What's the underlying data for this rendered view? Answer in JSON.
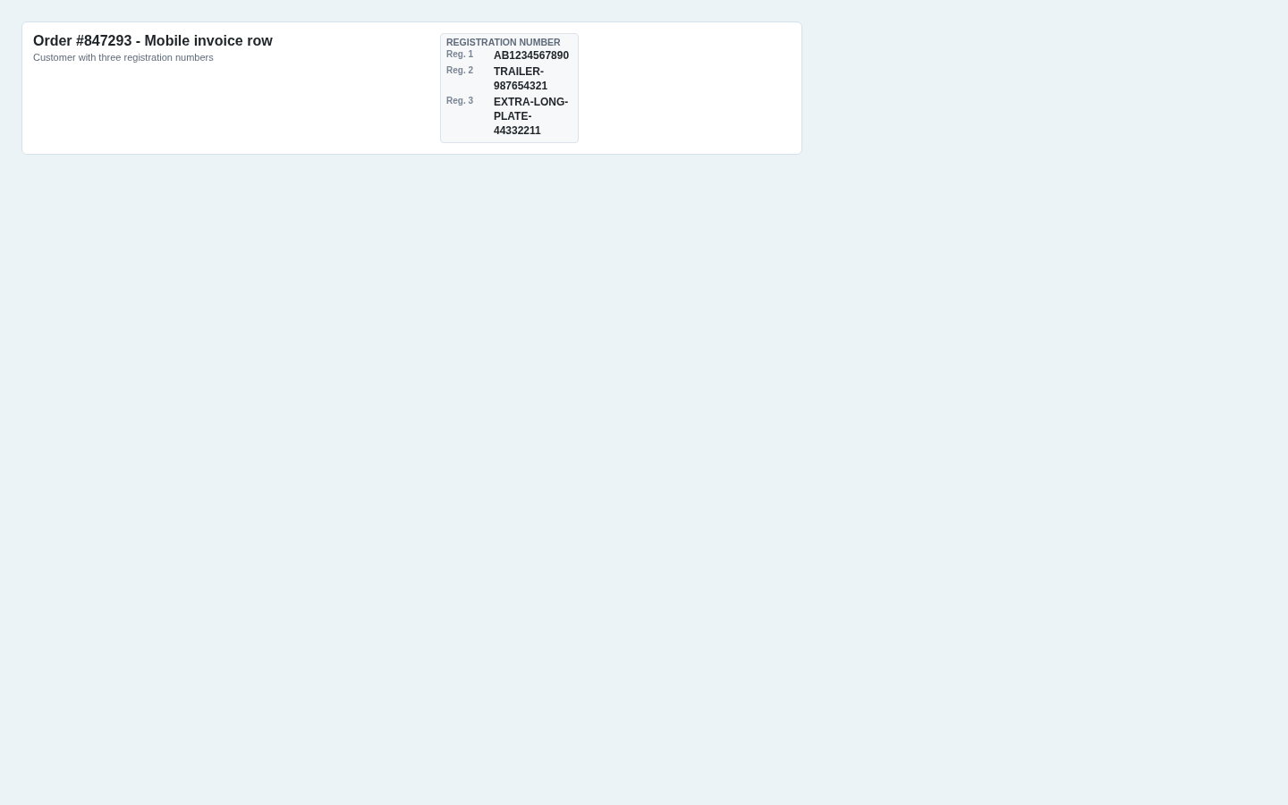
{
  "order": {
    "title": "Order #847293 - Mobile invoice row",
    "subtitle": "Customer with three registration numbers"
  },
  "registration": {
    "heading": "REGISTRATION NUMBER",
    "entries": [
      {
        "label": "Reg. 1",
        "value": "AB1234567890"
      },
      {
        "label": "Reg. 2",
        "value": "TRAILER-987654321"
      },
      {
        "label": "Reg. 3",
        "value": "EXTRA-LONG-PLATE-44332211"
      }
    ]
  }
}
